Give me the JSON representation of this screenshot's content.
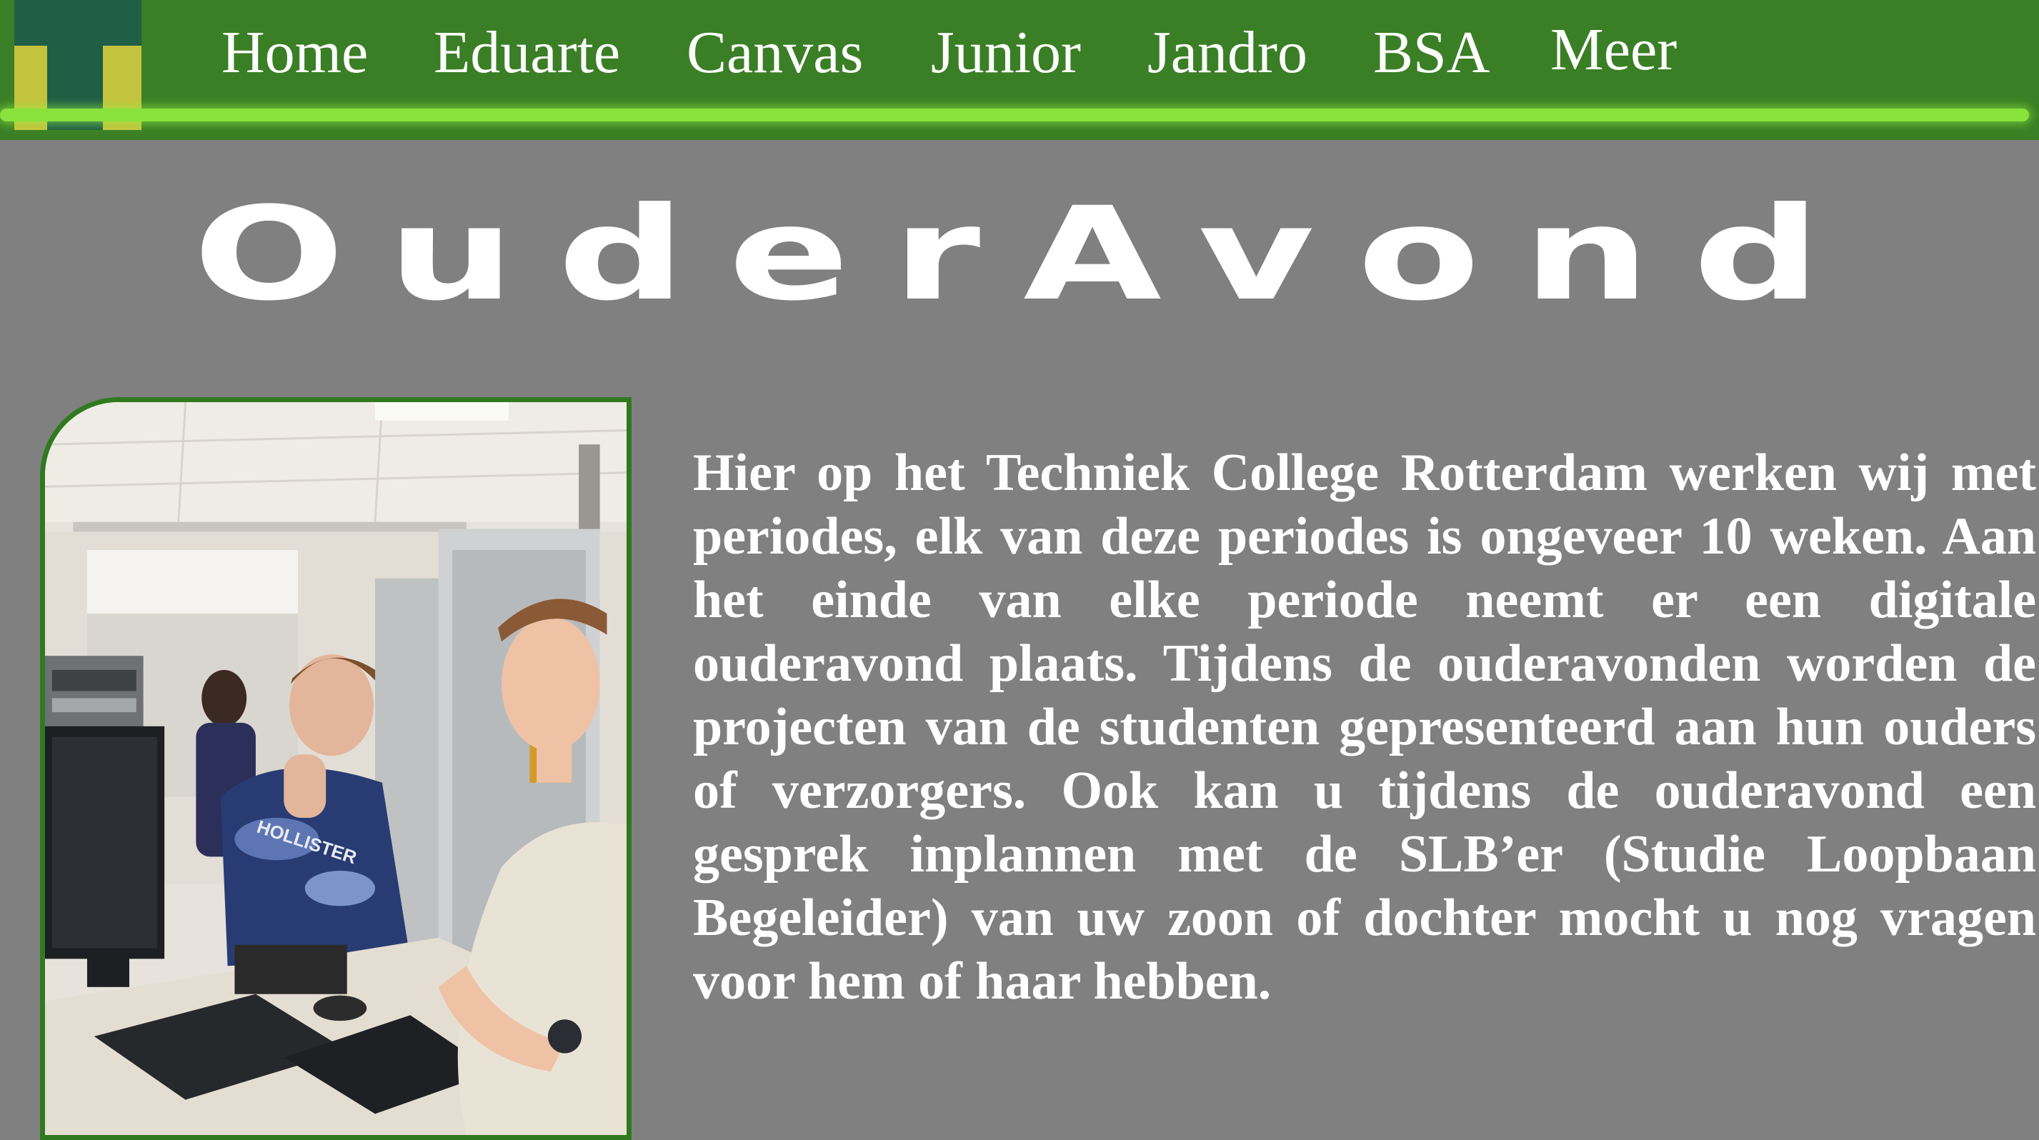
{
  "nav": {
    "items": [
      {
        "label": "Home"
      },
      {
        "label": "Eduarte"
      },
      {
        "label": "Canvas"
      },
      {
        "label": "Junior"
      },
      {
        "label": "Jandro"
      },
      {
        "label": "BSA"
      },
      {
        "label": "Meer"
      }
    ]
  },
  "page": {
    "title": "OuderAvond",
    "intro": "Hier op het Techniek College Rotterdam werken wij met periodes, elk van deze periodes is ongeveer 10 weken. Aan het einde van elke periode neemt er een digitale ouderavond plaats. Tijdens de ouderavonden worden de projecten van de studenten gepresenteerd aan hun ouders of verzorgers. Ook kan u tijdens de ouderavond een gesprek inplannen met de SLB’er (Studie Loopbaan Begeleider) van uw zoon of dochter mocht u nog vragen voor hem of haar hebben."
  },
  "photo": {
    "shirt_print": "HOLLISTER"
  },
  "colors": {
    "navbar": "#3a7f25",
    "nav_glow": "#8ae23c",
    "background": "#808080",
    "logo_dark": "#1f5f45",
    "logo_yellow": "#c3c33e",
    "text": "#ffffff"
  }
}
